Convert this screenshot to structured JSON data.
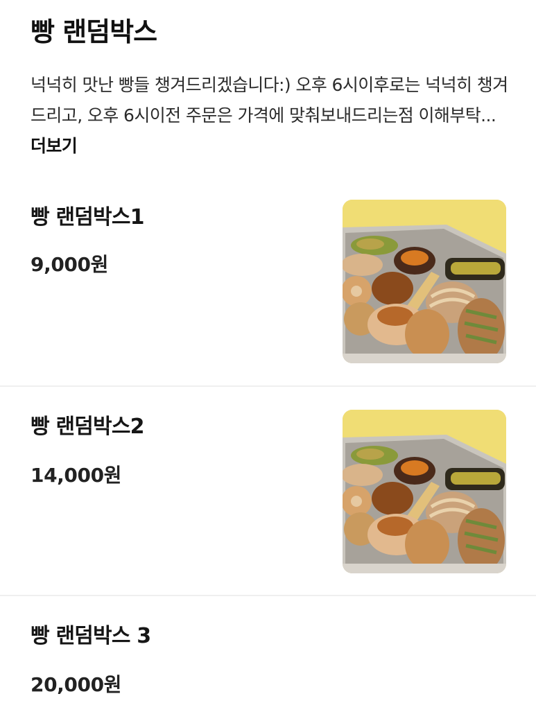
{
  "category": {
    "title": "빵 랜덤박스",
    "description": "넉넉히 맛난 빵들 챙겨드리겠습니다:) 오후 6시이후로는 넉넉히 챙겨드리고, 오후 6시이전 주문은 가격에 맞춰보내드리는점 이해부탁...",
    "more_label": "더보기"
  },
  "menu_items": [
    {
      "name": "빵 랜덤박스1",
      "price": "9,000원",
      "image": "bread-box-photo"
    },
    {
      "name": "빵 랜덤박스2",
      "price": "14,000원",
      "image": "bread-box-photo"
    },
    {
      "name": "빵 랜덤박스 3",
      "price": "20,000원"
    }
  ]
}
